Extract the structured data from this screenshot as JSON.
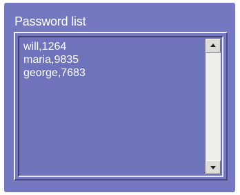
{
  "window": {
    "title": "Password list"
  },
  "list": {
    "items": [
      "will,1264",
      "maria,9835",
      "george,7683"
    ]
  },
  "scrollbar": {
    "up_icon": "arrow-up-icon",
    "down_icon": "arrow-down-icon"
  },
  "colors": {
    "panel": "#7378c0",
    "listbox": "#6e73bc",
    "text": "#ffffff",
    "scroll_track": "#eeeeec"
  }
}
